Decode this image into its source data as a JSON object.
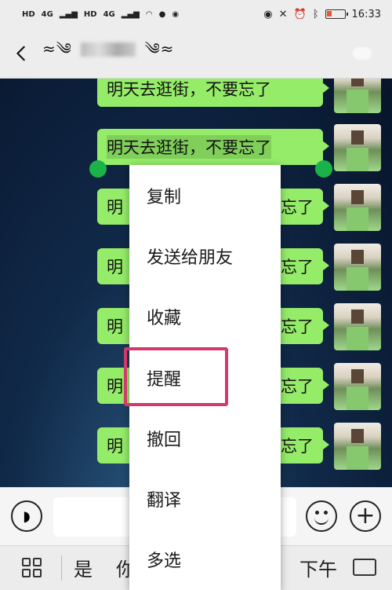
{
  "status_bar": {
    "left_labels": [
      "HD",
      "4G",
      "HD",
      "4G"
    ],
    "time": "16:33"
  },
  "header": {
    "title_left": "≈༄",
    "title_right": "༄≈"
  },
  "messages": [
    {
      "text": "明天去逛街，不要忘了"
    },
    {
      "text": "明天去逛街，不要忘了"
    },
    {
      "text_start": "明",
      "text_end": "忘了"
    },
    {
      "text_start": "明",
      "text_end": "忘了"
    },
    {
      "text_start": "明",
      "text_end": "忘了"
    },
    {
      "text_start": "明",
      "text_end": "忘了"
    },
    {
      "text_start": "明",
      "text_end": "忘了"
    }
  ],
  "context_menu": {
    "items": [
      "复制",
      "发送给朋友",
      "收藏",
      "提醒",
      "撤回",
      "翻译",
      "多选"
    ],
    "highlighted": "提醒"
  },
  "input_bar": {
    "voice_icon": "voice-icon",
    "emoji_icon": "emoji-icon",
    "plus_icon": "plus-icon"
  },
  "suggestions": {
    "words": [
      "是",
      "你",
      "下午"
    ]
  },
  "colors": {
    "bubble": "#95ec69",
    "highlight": "#d23a6a",
    "handle": "#1ab34a"
  }
}
